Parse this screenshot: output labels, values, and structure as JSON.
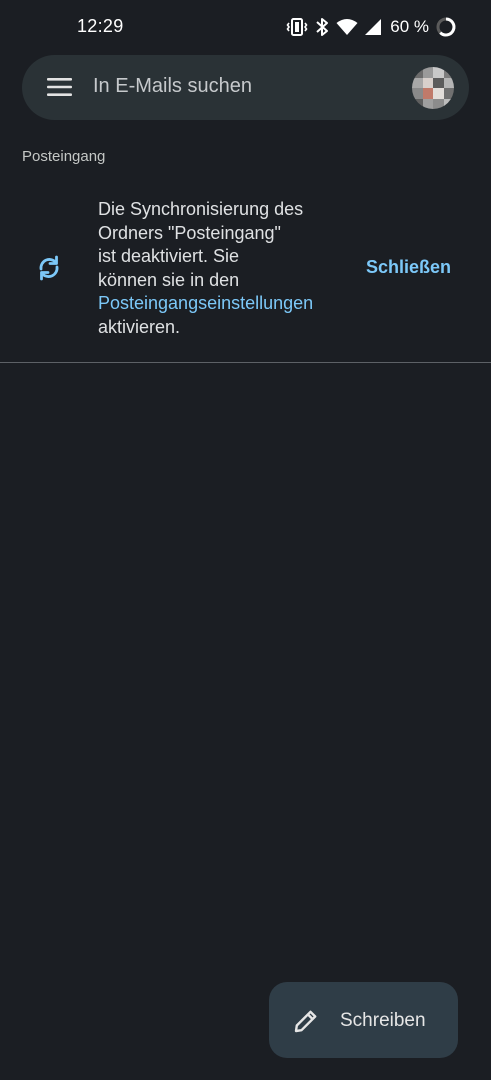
{
  "status_bar": {
    "time": "12:29",
    "battery": "60 %",
    "icons": [
      "vibrate-icon",
      "bluetooth-icon",
      "wifi-icon",
      "signal-icon",
      "battery-ring-icon"
    ]
  },
  "search": {
    "placeholder": "In E-Mails suchen",
    "menu_icon": "hamburger-menu-icon",
    "avatar": "account-avatar"
  },
  "folder": {
    "label": "Posteingang"
  },
  "banner": {
    "icon": "sync-icon",
    "lines": [
      "Die Synchronisierung des",
      "Ordners \"Posteingang\"",
      "ist deaktiviert. Sie",
      "können sie in den"
    ],
    "link_text": "Posteingangseinstellungen",
    "after_link": "aktivieren.",
    "close_label": "Schließen"
  },
  "fab": {
    "icon": "pencil-icon",
    "label": "Schreiben"
  },
  "colors": {
    "background": "#1b1e23",
    "search_bar": "#2a3236",
    "accent": "#7cc8f8",
    "fab": "#2f3d47"
  }
}
